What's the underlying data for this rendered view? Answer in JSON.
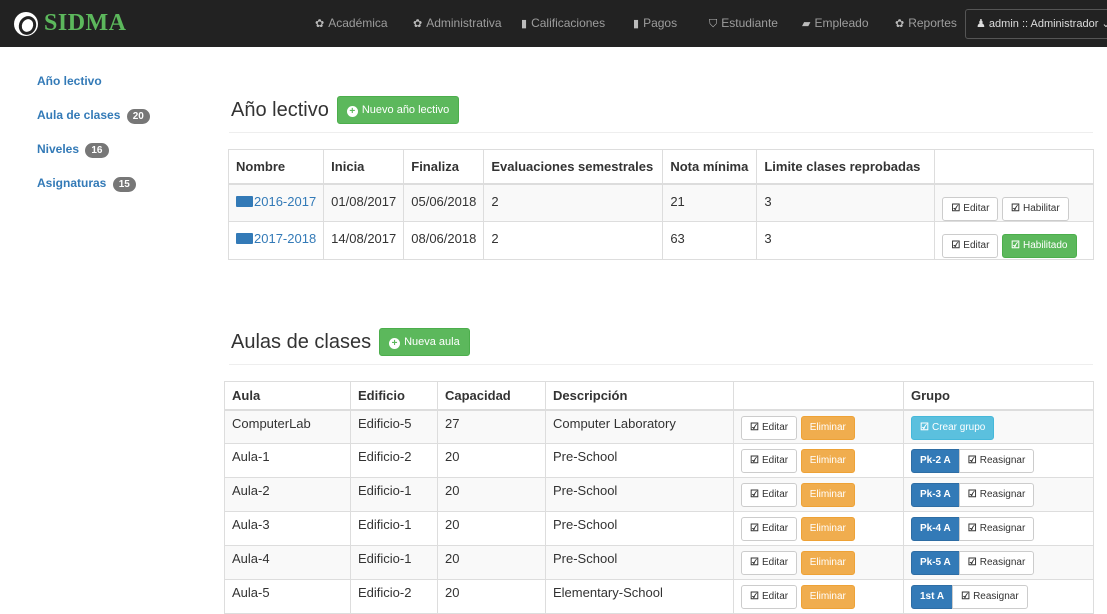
{
  "navbar": {
    "brand": "SIDMA",
    "items": [
      {
        "label": "Académica",
        "icon": "gear-icon",
        "glyph": "✿"
      },
      {
        "label": "Administrativa",
        "icon": "gear-icon",
        "glyph": "✿"
      },
      {
        "label": "Calificaciones",
        "icon": "file-icon",
        "glyph": "▮"
      },
      {
        "label": "Pagos",
        "icon": "file-icon",
        "glyph": "▮"
      },
      {
        "label": "Estudiante",
        "icon": "graduation-cap-icon",
        "glyph": "⛉"
      },
      {
        "label": "Empleado",
        "icon": "folder-open-icon",
        "glyph": "▰"
      },
      {
        "label": "Reportes",
        "icon": "gear-icon",
        "glyph": "✿"
      }
    ],
    "user": "admin :: Administrador"
  },
  "sidebar": {
    "items": [
      {
        "label": "Año lectivo",
        "badge": null
      },
      {
        "label": "Aula de clases",
        "badge": "20"
      },
      {
        "label": "Niveles",
        "badge": "16"
      },
      {
        "label": "Asignaturas",
        "badge": "15"
      }
    ]
  },
  "years": {
    "title": "Año lectivo",
    "new_button": "Nuevo año lectivo",
    "headers": [
      "Nombre",
      "Inicia",
      "Finaliza",
      "Evaluaciones semestrales",
      "Nota mínima",
      "Limite clases reprobadas",
      ""
    ],
    "rows": [
      {
        "name": "2016-2017",
        "start": "01/08/2017",
        "end": "05/06/2018",
        "evals": "2",
        "min": "21",
        "limit": "3",
        "edit": "Editar",
        "toggle": "Habilitar",
        "enabled": false
      },
      {
        "name": "2017-2018",
        "start": "14/08/2017",
        "end": "08/06/2018",
        "evals": "2",
        "min": "63",
        "limit": "3",
        "edit": "Editar",
        "toggle": "Habilitado",
        "enabled": true
      }
    ]
  },
  "rooms": {
    "title": "Aulas de clases",
    "new_button": "Nueva aula",
    "headers": [
      "Aula",
      "Edificio",
      "Capacidad",
      "Descripción",
      "",
      "Grupo"
    ],
    "edit_label": "Editar",
    "delete_label": "Eliminar",
    "create_group_label": "Crear grupo",
    "reassign_label": "Reasignar",
    "rows": [
      {
        "aula": "ComputerLab",
        "edificio": "Edificio-5",
        "capacidad": "27",
        "descripcion": "Computer Laboratory",
        "grupo": null
      },
      {
        "aula": "Aula-1",
        "edificio": "Edificio-2",
        "capacidad": "20",
        "descripcion": "Pre-School",
        "grupo": "Pk-2 A"
      },
      {
        "aula": "Aula-2",
        "edificio": "Edificio-1",
        "capacidad": "20",
        "descripcion": "Pre-School",
        "grupo": "Pk-3 A"
      },
      {
        "aula": "Aula-3",
        "edificio": "Edificio-1",
        "capacidad": "20",
        "descripcion": "Pre-School",
        "grupo": "Pk-4 A"
      },
      {
        "aula": "Aula-4",
        "edificio": "Edificio-1",
        "capacidad": "20",
        "descripcion": "Pre-School",
        "grupo": "Pk-5 A"
      },
      {
        "aula": "Aula-5",
        "edificio": "Edificio-2",
        "capacidad": "20",
        "descripcion": "Elementary-School",
        "grupo": "1st A"
      }
    ]
  },
  "colors": {
    "brand": "#5cb85c",
    "link": "#337ab7",
    "navbar": "#222222",
    "warning": "#f0ad4e",
    "info": "#5bc0de"
  }
}
